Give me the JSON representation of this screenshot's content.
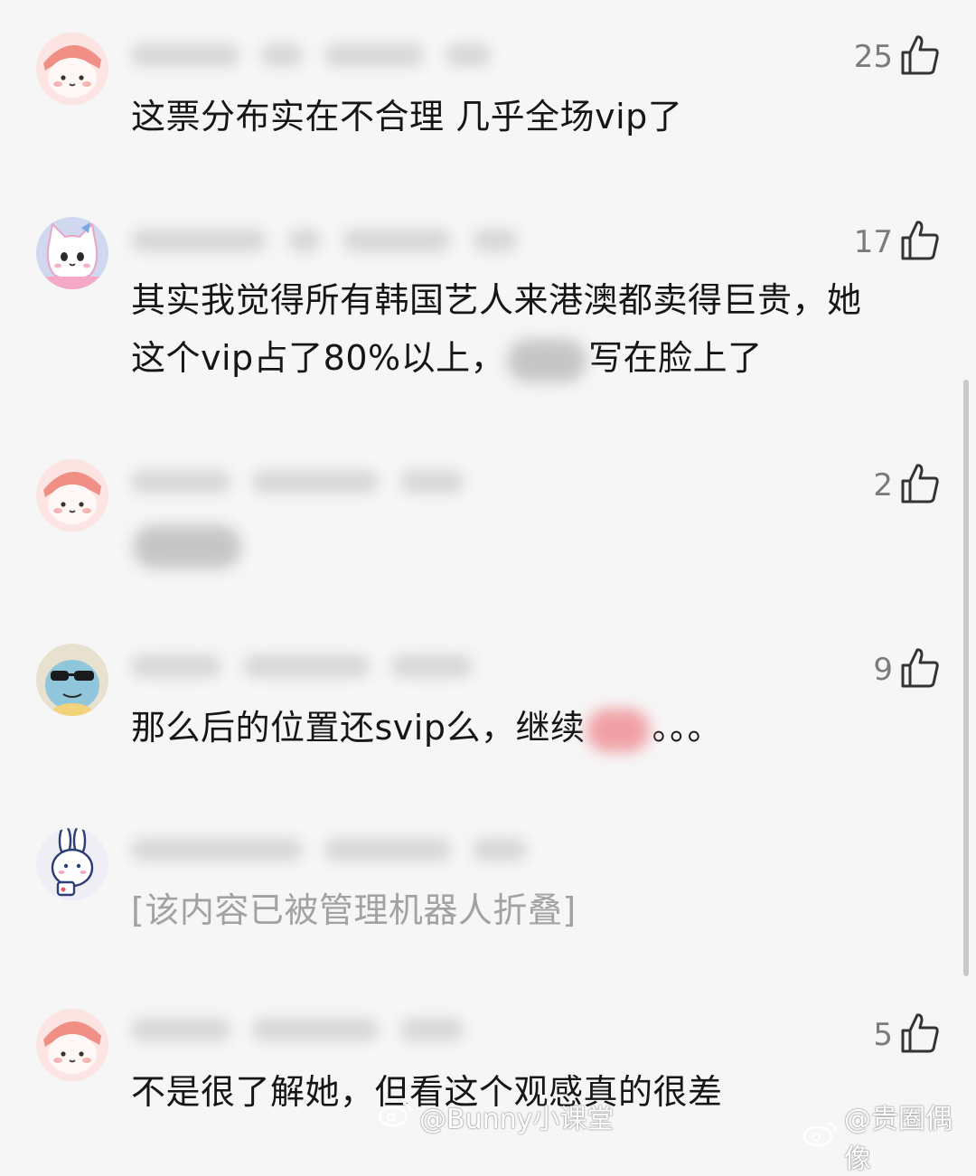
{
  "comments": [
    {
      "likes": "25",
      "text": "这票分布实在不合理 几乎全场vip了"
    },
    {
      "likes": "17",
      "text_line1": "其实我觉得所有韩国艺人来港澳都卖得巨贵，她",
      "text_line2_a": "这个vip占了80%以上，",
      "text_line2_b": "写在脸上了"
    },
    {
      "likes": "2"
    },
    {
      "likes": "9",
      "text_a": "那么后的位置还svip么，继续",
      "text_b": "。。。"
    },
    {
      "text": "[该内容已被管理机器人折叠]"
    },
    {
      "likes": "5",
      "text": "不是很了解她，但看这个观感真的很差"
    }
  ],
  "watermarks": {
    "left": "@Bunny小课堂",
    "right": "@贵圈偶像"
  },
  "icons": {
    "like": "thumbs-up-icon",
    "weibo": "weibo-logo-icon"
  },
  "colors": {
    "background": "#f6f6f6",
    "text": "#161616",
    "like_count": "#7b7b7b",
    "folded_text": "#a2a2a2"
  }
}
